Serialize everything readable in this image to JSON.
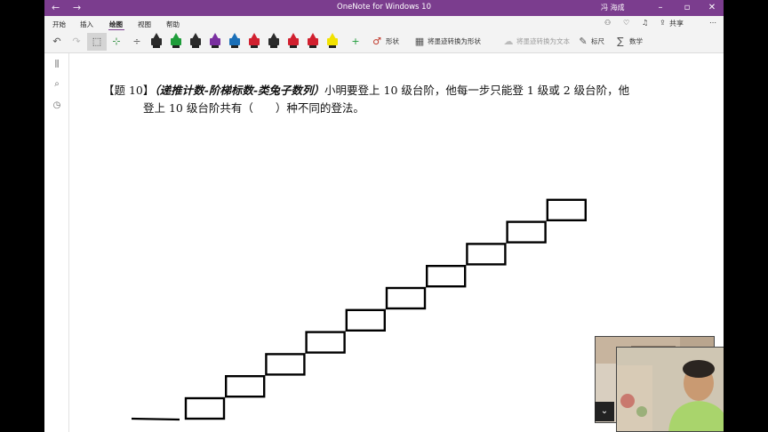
{
  "window": {
    "title": "OneNote for Windows 10",
    "user": "冯 海成",
    "back_icon": "back-arrow-icon",
    "forward_icon": "forward-arrow-icon"
  },
  "menu": {
    "tabs": [
      "开始",
      "插入",
      "绘图",
      "视图",
      "帮助"
    ],
    "active_tab": "绘图",
    "share_label": "共享"
  },
  "toolbar": {
    "shape_label": "形状",
    "ink_to_shape_label": "将墨迹转换为形状",
    "ink_to_text_label": "将墨迹转换为文本",
    "ruler_label": "标尺",
    "math_label": "数学",
    "pen_colors": [
      "#2b2b2b",
      "#1f9d3a",
      "#2b2b2b",
      "#7a2fa0",
      "#1a6fb8",
      "#d1202f",
      "#2b2b2b",
      "#d1202f",
      "#d1202f",
      "#f2e200"
    ],
    "accent": "#7b3d8e"
  },
  "question": {
    "prefix": "【题 10】",
    "tag": "（递推计数-阶梯标数-类兔子数列）",
    "line1_rest": "小明要登上 10 级台阶，他每一步只能登 1 级或 2 级台阶，他",
    "line2": "登上 10 级台阶共有（　　）种不同的登法。"
  },
  "drawing": {
    "step_count": 10
  }
}
